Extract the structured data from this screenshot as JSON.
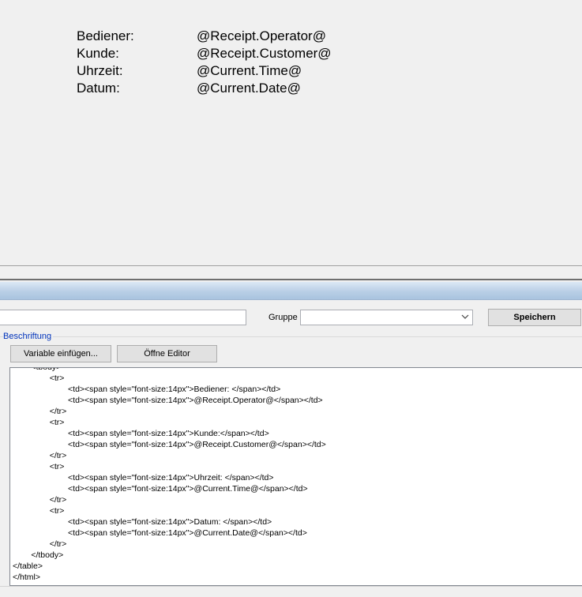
{
  "preview": {
    "rows": [
      {
        "label": "Bediener:",
        "value": "@Receipt.Operator@"
      },
      {
        "label": "Kunde:",
        "value": "@Receipt.Customer@"
      },
      {
        "label": "Uhrzeit:",
        "value": "@Current.Time@"
      },
      {
        "label": "Datum:",
        "value": "@Current.Date@"
      }
    ]
  },
  "form": {
    "name_value": "",
    "gruppe_label": "Gruppe",
    "gruppe_value": "",
    "save_label": "Speichern"
  },
  "beschriftung": {
    "title": "Beschriftung",
    "insert_variable_label": "Variable einfügen...",
    "open_editor_label": "Öffne Editor"
  },
  "editor": {
    "lines": [
      "\t<tbody>",
      "\t\t<tr>",
      "\t\t\t<td><span style=\"font-size:14px\">Bediener: </span></td>",
      "\t\t\t<td><span style=\"font-size:14px\">@Receipt.Operator@</span></td>",
      "\t\t</tr>",
      "\t\t<tr>",
      "\t\t\t<td><span style=\"font-size:14px\">Kunde:</span></td>",
      "\t\t\t<td><span style=\"font-size:14px\">@Receipt.Customer@</span></td>",
      "\t\t</tr>",
      "\t\t<tr>",
      "\t\t\t<td><span style=\"font-size:14px\">Uhrzeit: </span></td>",
      "\t\t\t<td><span style=\"font-size:14px\">@Current.Time@</span></td>",
      "\t\t</tr>",
      "\t\t<tr>",
      "\t\t\t<td><span style=\"font-size:14px\">Datum: </span></td>",
      "\t\t\t<td><span style=\"font-size:14px\">@Current.Date@</span></td>",
      "\t\t</tr>",
      "\t</tbody>",
      "</table>",
      "</html>"
    ]
  }
}
